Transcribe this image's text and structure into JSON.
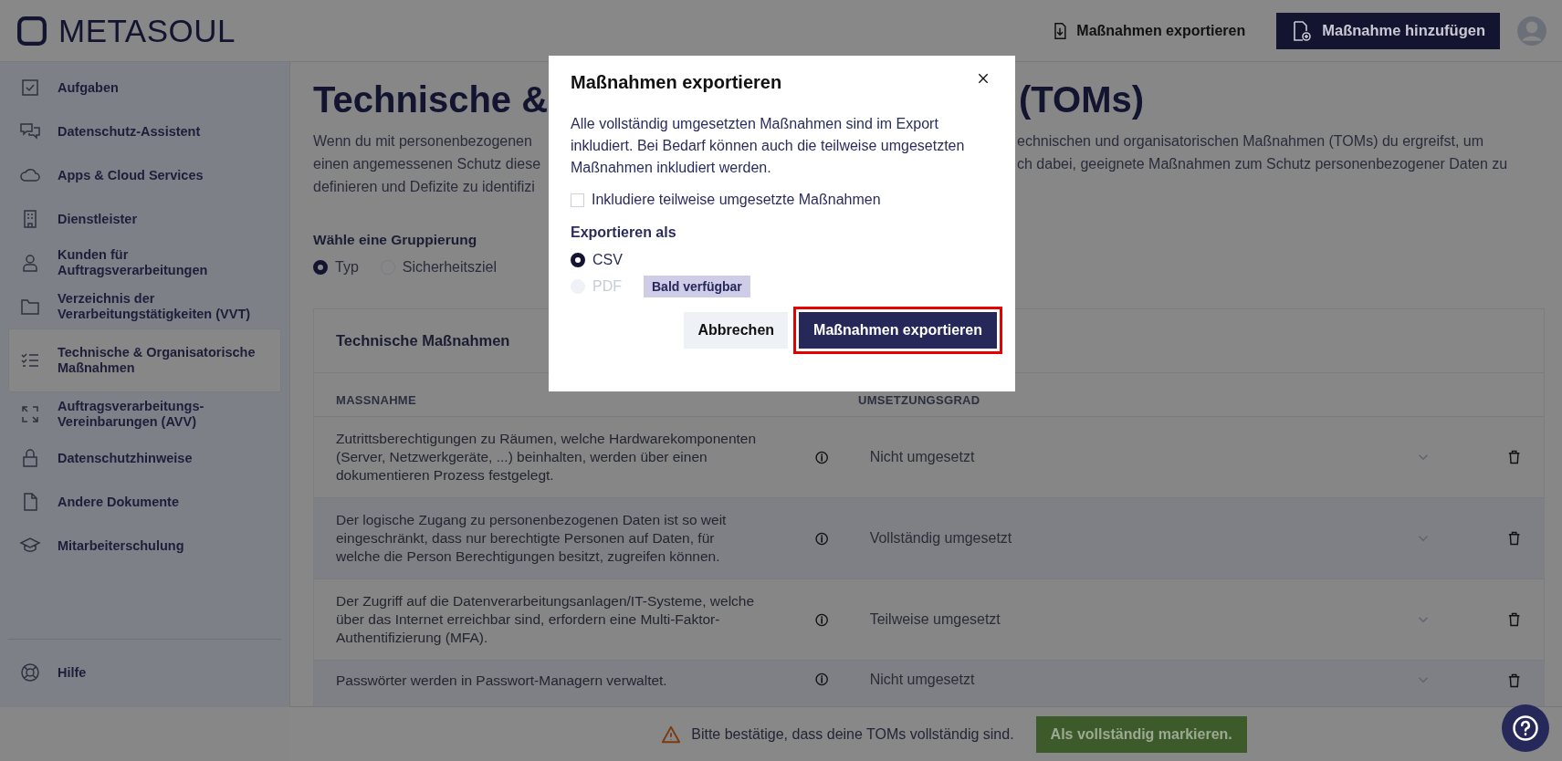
{
  "header": {
    "logo": "METASOUL",
    "export_link": "Maßnahmen exportieren",
    "add_button": "Maßnahme hinzufügen"
  },
  "sidebar": {
    "items": [
      {
        "label": "Aufgaben",
        "selected": false
      },
      {
        "label": "Datenschutz-Assistent",
        "selected": false
      },
      {
        "label": "Apps & Cloud Services",
        "selected": false
      },
      {
        "label": "Dienstleister",
        "selected": false
      },
      {
        "label": "Kunden für\nAuftragsverarbeitungen",
        "selected": false
      },
      {
        "label": "Verzeichnis der\nVerarbeitungstätigkeiten (VVT)",
        "selected": false
      },
      {
        "label": "Technische & Organisatorische\nMaßnahmen",
        "selected": true
      },
      {
        "label": "Auftragsverarbeitungs-\nVereinbarungen (AVV)",
        "selected": false
      },
      {
        "label": "Datenschutzhinweise",
        "selected": false
      },
      {
        "label": "Andere Dokumente",
        "selected": false
      },
      {
        "label": "Mitarbeiterschulung",
        "selected": false
      }
    ],
    "help": "Hilfe"
  },
  "page": {
    "title_left": "Technische &",
    "title_right": "(TOMs)",
    "intro_left": [
      "Wenn du mit personenbezogenen",
      "einen angemessenen Schutz diese",
      "definieren und Defizite zu identifizi"
    ],
    "intro_right": [
      "echnischen und organisatorischen Maßnahmen (TOMs) du ergreifst, um",
      "ch dabei, geeignete Maßnahmen zum Schutz personenbezogener Daten zu"
    ],
    "grouping": {
      "label": "Wähle eine Gruppierung",
      "options": [
        {
          "label": "Typ",
          "selected": true
        },
        {
          "label": "Sicherheitsziel",
          "selected": false
        }
      ]
    },
    "card": {
      "title": "Technische Maßnahmen",
      "columns": [
        "MASSNAHME",
        "UMSETZUNGSGRAD"
      ],
      "rows": [
        {
          "text": "Zutrittsberechtigungen zu Räumen, welche Hardwarekomponenten (Server, Netzwerkgeräte, ...) beinhalten, werden über einen dokumentieren Prozess festgelegt.",
          "status": "Nicht umgesetzt"
        },
        {
          "text": "Der logische Zugang zu personenbezogenen Daten ist so weit eingeschränkt, dass nur berechtigte Personen auf Daten, für welche die Person Berechtigungen besitzt, zugreifen können.",
          "status": "Vollständig umgesetzt"
        },
        {
          "text": "Der Zugriff auf die Datenverarbeitungsanlagen/IT-Systeme, welche über das Internet erreichbar sind, erfordern eine Multi-Faktor-Authentifizierung (MFA).",
          "status": "Teilweise umgesetzt"
        },
        {
          "text": "Passwörter werden in Passwort-Managern verwaltet.",
          "status": "Nicht umgesetzt"
        }
      ]
    }
  },
  "footer": {
    "warning": "Bitte bestätige, dass deine TOMs vollständig sind.",
    "button": "Als vollständig markieren."
  },
  "dialog": {
    "title": "Maßnahmen exportieren",
    "text": "Alle vollständig umgesetzten Maßnahmen sind im Export inkludiert. Bei Bedarf können auch die teilweise umgesetzten Maßnahmen inkludiert werden.",
    "checkbox": {
      "label": "Inkludiere teilweise umgesetzte Maßnahmen",
      "checked": false
    },
    "format_label": "Exportieren als",
    "formats": [
      {
        "label": "CSV",
        "selected": true,
        "disabled": false
      },
      {
        "label": "PDF",
        "selected": false,
        "disabled": true,
        "badge": "Bald verfügbar"
      }
    ],
    "cancel": "Abbrechen",
    "confirm": "Maßnahmen exportieren",
    "confirm_highlighted": true
  }
}
